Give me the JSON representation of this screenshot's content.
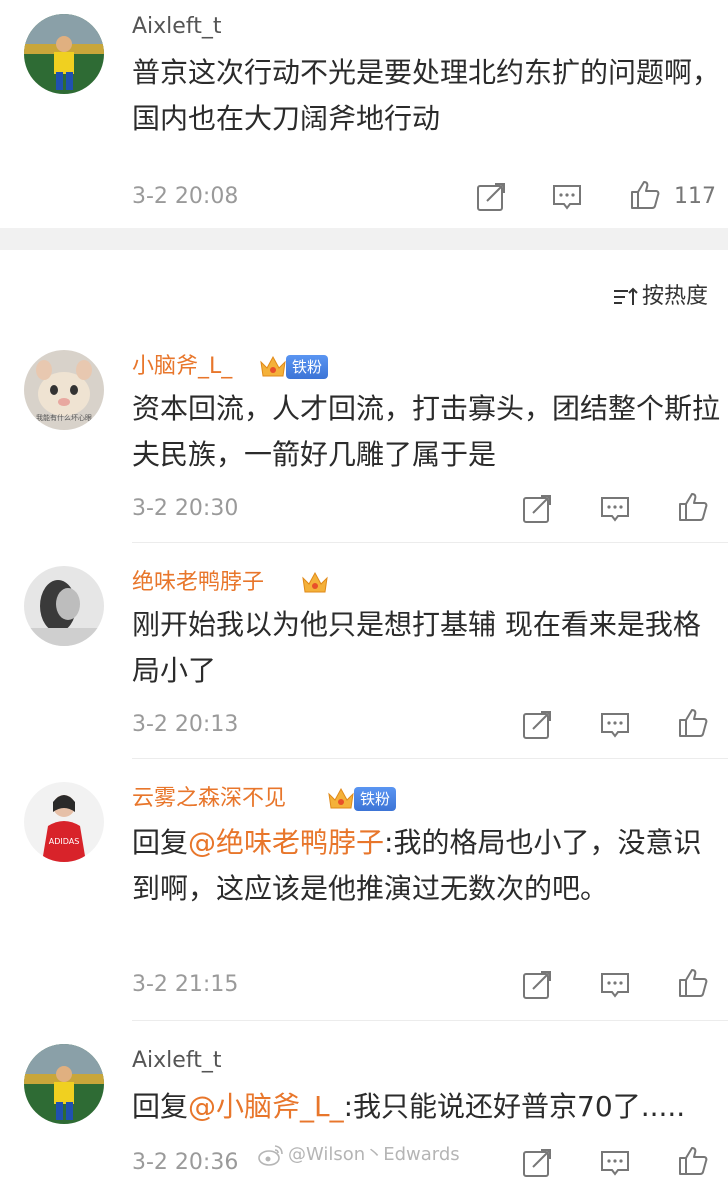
{
  "top_comment": {
    "username": "Aixleft_t",
    "text": "普京这次行动不光是要处理北约东扩的问题啊，国内也在大刀阔斧地行动",
    "time": "3-2 20:08",
    "like_count": "117"
  },
  "sort_label": "按热度",
  "replies": [
    {
      "username": "小脑斧_L_",
      "badge": "铁粉",
      "avatar_caption": "我能有什么坏心眼",
      "text": "资本回流，人才回流，打击寡头，团结整个斯拉夫民族，一箭好几雕了属于是",
      "time": "3-2 20:30"
    },
    {
      "username": "绝味老鸭脖子",
      "text": "刚开始我以为他只是想打基辅 现在看来是我格局小了",
      "time": "3-2 20:13"
    },
    {
      "username": "云雾之森深不见",
      "badge": "铁粉",
      "reply_prefix": "回复",
      "mention": "@绝味老鸭脖子",
      "text": ":我的格局也小了，没意识到啊，这应该是他推演过无数次的吧。",
      "time": "3-2 21:15"
    },
    {
      "username": "Aixleft_t",
      "reply_prefix": "回复",
      "mention": "@小脑斧_L_",
      "text": ":我只能说还好普京70了.....",
      "time": "3-2 20:36"
    }
  ],
  "watermark": "@Wilson丶Edwards",
  "colors": {
    "username_orange": "#e8762b",
    "badge_blue": "#4a84e6",
    "divider": "#f1f1f1"
  }
}
